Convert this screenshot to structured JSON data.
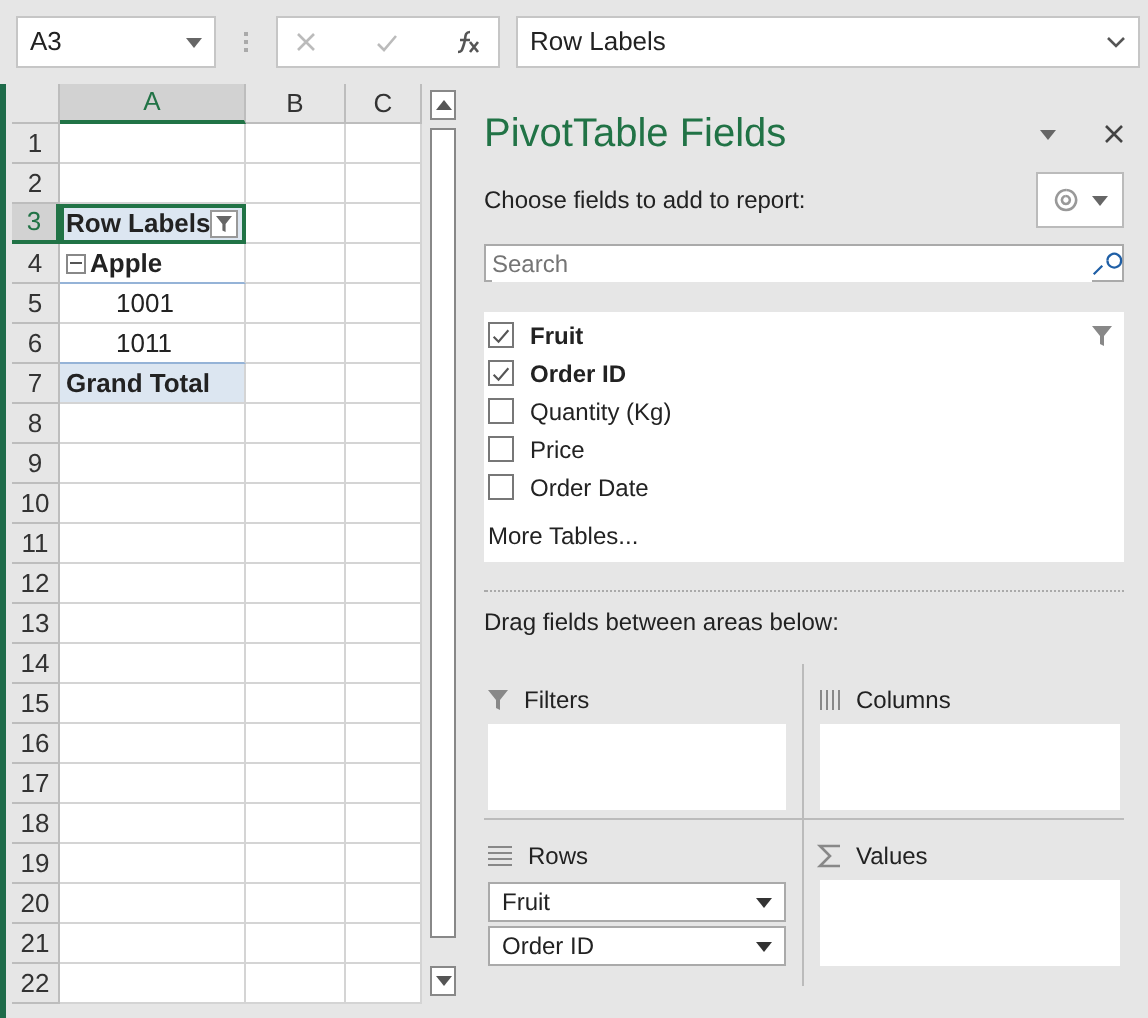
{
  "name_box": {
    "value": "A3"
  },
  "formula_bar": {
    "value": "Row Labels"
  },
  "sheet": {
    "columns": [
      {
        "label": "A",
        "selected": true
      },
      {
        "label": "B",
        "selected": false
      },
      {
        "label": "C",
        "selected": false
      }
    ],
    "rows": [
      {
        "number": "1",
        "selected": false
      },
      {
        "number": "2",
        "selected": false
      },
      {
        "number": "3",
        "selected": true,
        "cell": {
          "text": "Row Labels",
          "kind": "header"
        }
      },
      {
        "number": "4",
        "selected": false,
        "cell": {
          "text": "Apple",
          "kind": "group",
          "expanded": true
        }
      },
      {
        "number": "5",
        "selected": false,
        "cell": {
          "text": "1001",
          "kind": "item"
        }
      },
      {
        "number": "6",
        "selected": false,
        "cell": {
          "text": "1011",
          "kind": "item"
        }
      },
      {
        "number": "7",
        "selected": false,
        "cell": {
          "text": "Grand Total",
          "kind": "total"
        }
      },
      {
        "number": "8",
        "selected": false
      },
      {
        "number": "9",
        "selected": false
      },
      {
        "number": "10",
        "selected": false
      },
      {
        "number": "11",
        "selected": false
      },
      {
        "number": "12",
        "selected": false
      },
      {
        "number": "13",
        "selected": false
      },
      {
        "number": "14",
        "selected": false
      },
      {
        "number": "15",
        "selected": false
      },
      {
        "number": "16",
        "selected": false
      },
      {
        "number": "17",
        "selected": false
      },
      {
        "number": "18",
        "selected": false
      },
      {
        "number": "19",
        "selected": false
      },
      {
        "number": "20",
        "selected": false
      },
      {
        "number": "21",
        "selected": false
      },
      {
        "number": "22",
        "selected": false
      }
    ]
  },
  "pane": {
    "title": "PivotTable Fields",
    "subtitle": "Choose fields to add to report:",
    "search": {
      "placeholder": "Search"
    },
    "fields": [
      {
        "label": "Fruit",
        "checked": true,
        "filtered": true
      },
      {
        "label": "Order ID",
        "checked": true,
        "filtered": false
      },
      {
        "label": "Quantity (Kg)",
        "checked": false,
        "filtered": false
      },
      {
        "label": "Price",
        "checked": false,
        "filtered": false
      },
      {
        "label": "Order Date",
        "checked": false,
        "filtered": false
      }
    ],
    "more_tables": "More Tables...",
    "drag_hint": "Drag fields between areas below:",
    "areas": [
      {
        "label": "Filters",
        "kind": "filters"
      },
      {
        "label": "Columns",
        "kind": "columns"
      },
      {
        "label": "Rows",
        "kind": "rows",
        "items": [
          "Fruit",
          "Order ID"
        ]
      },
      {
        "label": "Values",
        "kind": "values"
      }
    ]
  }
}
